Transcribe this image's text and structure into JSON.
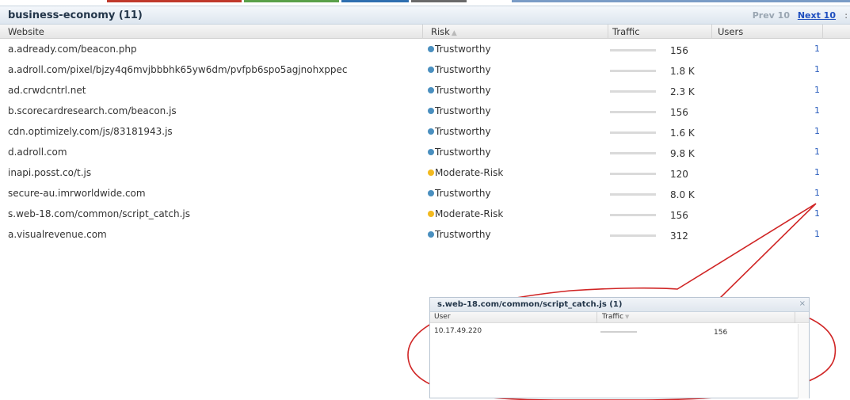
{
  "colors": {
    "trustworthy": "#4a8fbf",
    "moderate_risk": "#f2b91e",
    "callout": "#d02525",
    "link": "#2a5dbd",
    "tab_strip": [
      "#c0392b",
      "#5aa04a",
      "#2f6fb0",
      "#6a6a6a",
      "#7a9cc6"
    ]
  },
  "panel": {
    "title": "business-economy (11)",
    "pager": {
      "prev": "Prev 10",
      "next": "Next 10",
      "side": ":"
    },
    "columns": {
      "website": "Website",
      "risk": "Risk",
      "traffic": "Traffic",
      "users": "Users"
    }
  },
  "rows": [
    {
      "website": "a.adready.com/beacon.php",
      "risk": "Trustworthy",
      "risk_level": "trustworthy",
      "traffic": "156",
      "users": "1"
    },
    {
      "website": "a.adroll.com/pixel/bjzy4q6mvjbbbhk65yw6dm/pvfpb6spo5agjnohxppec",
      "risk": "Trustworthy",
      "risk_level": "trustworthy",
      "traffic": "1.8 K",
      "users": "1"
    },
    {
      "website": "ad.crwdcntrl.net",
      "risk": "Trustworthy",
      "risk_level": "trustworthy",
      "traffic": "2.3 K",
      "users": "1"
    },
    {
      "website": "b.scorecardresearch.com/beacon.js",
      "risk": "Trustworthy",
      "risk_level": "trustworthy",
      "traffic": "156",
      "users": "1"
    },
    {
      "website": "cdn.optimizely.com/js/83181943.js",
      "risk": "Trustworthy",
      "risk_level": "trustworthy",
      "traffic": "1.6 K",
      "users": "1"
    },
    {
      "website": "d.adroll.com",
      "risk": "Trustworthy",
      "risk_level": "trustworthy",
      "traffic": "9.8 K",
      "users": "1"
    },
    {
      "website": "inapi.posst.co/t.js",
      "risk": "Moderate-Risk",
      "risk_level": "moderate",
      "traffic": "120",
      "users": "1"
    },
    {
      "website": "secure-au.imrworldwide.com",
      "risk": "Trustworthy",
      "risk_level": "trustworthy",
      "traffic": "8.0 K",
      "users": "1"
    },
    {
      "website": "s.web-18.com/common/script_catch.js",
      "risk": "Moderate-Risk",
      "risk_level": "moderate",
      "traffic": "156",
      "users": "1"
    },
    {
      "website": "a.visualrevenue.com",
      "risk": "Trustworthy",
      "risk_level": "trustworthy",
      "traffic": "312",
      "users": "1"
    }
  ],
  "popup": {
    "title": "s.web-18.com/common/script_catch.js (1)",
    "close": "×",
    "columns": {
      "user": "User",
      "traffic": "Traffic"
    },
    "rows": [
      {
        "user": "10.17.49.220",
        "traffic": "156"
      }
    ]
  }
}
